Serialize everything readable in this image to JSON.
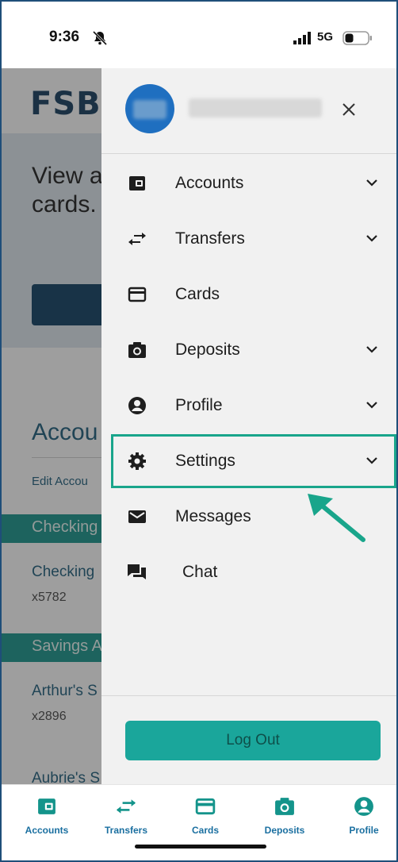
{
  "status_bar": {
    "time": "9:36",
    "network": "5G"
  },
  "background": {
    "logo": "FSB",
    "hero_text": "View a\ncards.",
    "accounts_title": "Accou",
    "edit_link": "Edit Accou",
    "sections": [
      {
        "band": "Checking",
        "account_name": "Checking",
        "account_number": "x5782"
      },
      {
        "band": "Savings A",
        "account_name": "Arthur's S",
        "account_number": "x2896"
      }
    ],
    "partial_account": "Aubrie's S"
  },
  "drawer": {
    "menu": [
      {
        "label": "Accounts",
        "icon": "wallet-icon",
        "expandable": true
      },
      {
        "label": "Transfers",
        "icon": "transfer-arrows-icon",
        "expandable": true
      },
      {
        "label": "Cards",
        "icon": "credit-card-icon",
        "expandable": false
      },
      {
        "label": "Deposits",
        "icon": "camera-icon",
        "expandable": true
      },
      {
        "label": "Profile",
        "icon": "user-circle-icon",
        "expandable": true
      },
      {
        "label": "Settings",
        "icon": "gear-icon",
        "expandable": true
      },
      {
        "label": "Messages",
        "icon": "envelope-icon",
        "expandable": false
      },
      {
        "label": "Chat",
        "icon": "chat-bubbles-icon",
        "expandable": false
      }
    ],
    "logout_label": "Log Out"
  },
  "bottom_nav": [
    {
      "label": "Accounts",
      "icon": "wallet-icon"
    },
    {
      "label": "Transfers",
      "icon": "transfer-arrows-icon"
    },
    {
      "label": "Cards",
      "icon": "credit-card-icon"
    },
    {
      "label": "Deposits",
      "icon": "camera-icon"
    },
    {
      "label": "Profile",
      "icon": "user-circle-icon"
    }
  ],
  "colors": {
    "accent_teal": "#1aa69b",
    "highlight_green": "#19a58b",
    "nav_blue": "#1a6fa0",
    "brand_navy": "#123a5c"
  }
}
